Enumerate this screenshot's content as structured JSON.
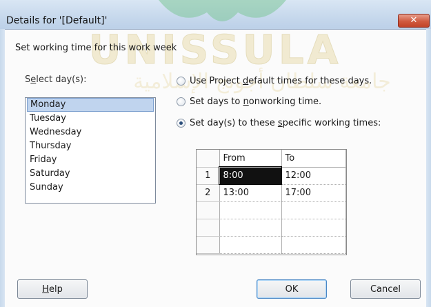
{
  "window": {
    "title": "Details for '[Default]'",
    "close_glyph": "✕"
  },
  "watermark": {
    "text": "UNISSULA",
    "arabic": "جامعة سلطان أجونج الإسلامية"
  },
  "heading": "Set working time for this work week",
  "day_select": {
    "label_before": "S",
    "label_accel": "e",
    "label_after": "lect day(s):",
    "days": [
      "Monday",
      "Tuesday",
      "Wednesday",
      "Thursday",
      "Friday",
      "Saturday",
      "Sunday"
    ],
    "selected": "Monday"
  },
  "options": [
    {
      "before": "Use Project ",
      "accel": "d",
      "after": "efault times for these days.",
      "checked": false
    },
    {
      "before": "Set days to ",
      "accel": "n",
      "after": "onworking time.",
      "checked": false
    },
    {
      "before": "Set day(s) to these ",
      "accel": "s",
      "after": "pecific working times:",
      "checked": true
    }
  ],
  "times_grid": {
    "headers": [
      "From",
      "To"
    ],
    "rows": [
      {
        "num": "1",
        "from": "8:00",
        "to": "12:00"
      },
      {
        "num": "2",
        "from": "13:00",
        "to": "17:00"
      },
      {
        "num": "",
        "from": "",
        "to": ""
      },
      {
        "num": "",
        "from": "",
        "to": ""
      },
      {
        "num": "",
        "from": "",
        "to": ""
      }
    ]
  },
  "buttons": {
    "help_accel": "H",
    "help_rest": "elp",
    "ok": "OK",
    "cancel": "Cancel"
  }
}
